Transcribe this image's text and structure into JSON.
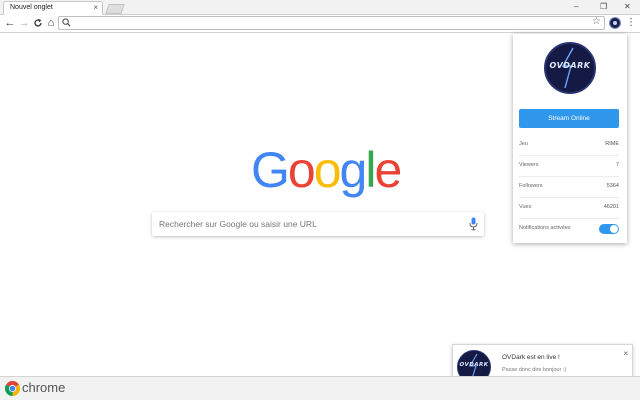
{
  "browser": {
    "tab_title": "Nouvel onglet",
    "tab_close": "×",
    "window_controls": [
      "–",
      "❐",
      "✕"
    ],
    "nav": {
      "back": "←",
      "forward": "→",
      "reload": "C",
      "home": "⌂"
    },
    "omnibox_value": "",
    "bookmark_star": "☆",
    "menu": "⋮"
  },
  "google": {
    "logo_letters": [
      {
        "ch": "G",
        "color": "#4285F4"
      },
      {
        "ch": "o",
        "color": "#EA4335"
      },
      {
        "ch": "o",
        "color": "#FBBC05"
      },
      {
        "ch": "g",
        "color": "#4285F4"
      },
      {
        "ch": "l",
        "color": "#34A853"
      },
      {
        "ch": "e",
        "color": "#EA4335"
      }
    ],
    "search_placeholder": "Rechercher sur Google ou saisir une URL"
  },
  "popup": {
    "logo_text": "OVDARK",
    "stream_button": "Stream Online",
    "stats": [
      {
        "label": "Jeu",
        "value": "RIME"
      },
      {
        "label": "Viewers",
        "value": "7"
      },
      {
        "label": "Followers",
        "value": "5364"
      },
      {
        "label": "Vues",
        "value": "46201"
      }
    ],
    "notifications_label": "Notifications activées",
    "notifications_on": true,
    "accent": "#2f97ec"
  },
  "notification": {
    "logo_text": "OVDARK",
    "title": "OVDark est en live !",
    "message": "Passe donc dire bonjour :)",
    "close": "×"
  },
  "taskbar": {
    "label": "chrome"
  }
}
